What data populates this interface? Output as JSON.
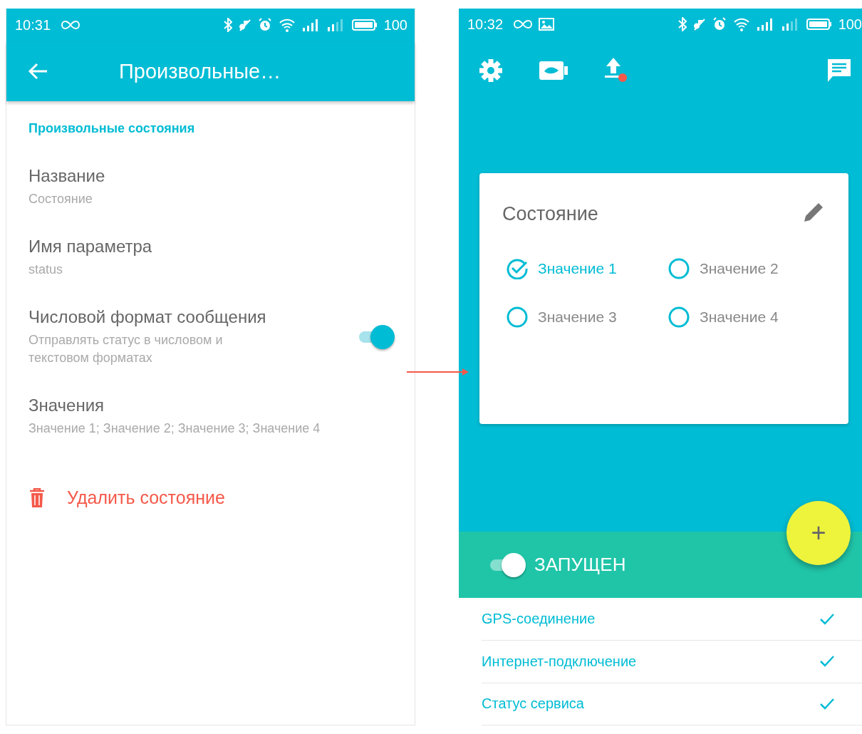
{
  "left_screen": {
    "status_bar": {
      "time": "10:31",
      "battery": "100"
    },
    "toolbar": {
      "title": "Произвольные…"
    },
    "section_header": "Произвольные состояния",
    "settings": [
      {
        "kind": "text",
        "title": "Название",
        "summary": "Состояние"
      },
      {
        "kind": "text",
        "title": "Имя параметра",
        "summary": "status"
      },
      {
        "kind": "switch",
        "title": "Числовой формат сообщения",
        "summary": "Отправлять статус в числовом и текстовом форматах",
        "on": true
      },
      {
        "kind": "text",
        "title": "Значения",
        "summary": "Значение 1; Значение 2; Значение 3; Значение 4"
      }
    ],
    "delete_action": "Удалить состояние"
  },
  "right_screen": {
    "status_bar": {
      "time": "10:32",
      "battery": "100"
    },
    "card": {
      "title": "Состояние",
      "options": [
        {
          "label": "Значение 1",
          "selected": true
        },
        {
          "label": "Значение 2",
          "selected": false
        },
        {
          "label": "Значение 3",
          "selected": false
        },
        {
          "label": "Значение 4",
          "selected": false
        }
      ]
    },
    "fab": {
      "label": "+"
    },
    "service": {
      "label": "ЗАПУЩЕН",
      "on": true
    },
    "checks": [
      {
        "label": "GPS-соединение",
        "checked": true
      },
      {
        "label": "Интернет-подключение",
        "checked": true
      },
      {
        "label": "Статус сервиса",
        "checked": true
      }
    ]
  }
}
